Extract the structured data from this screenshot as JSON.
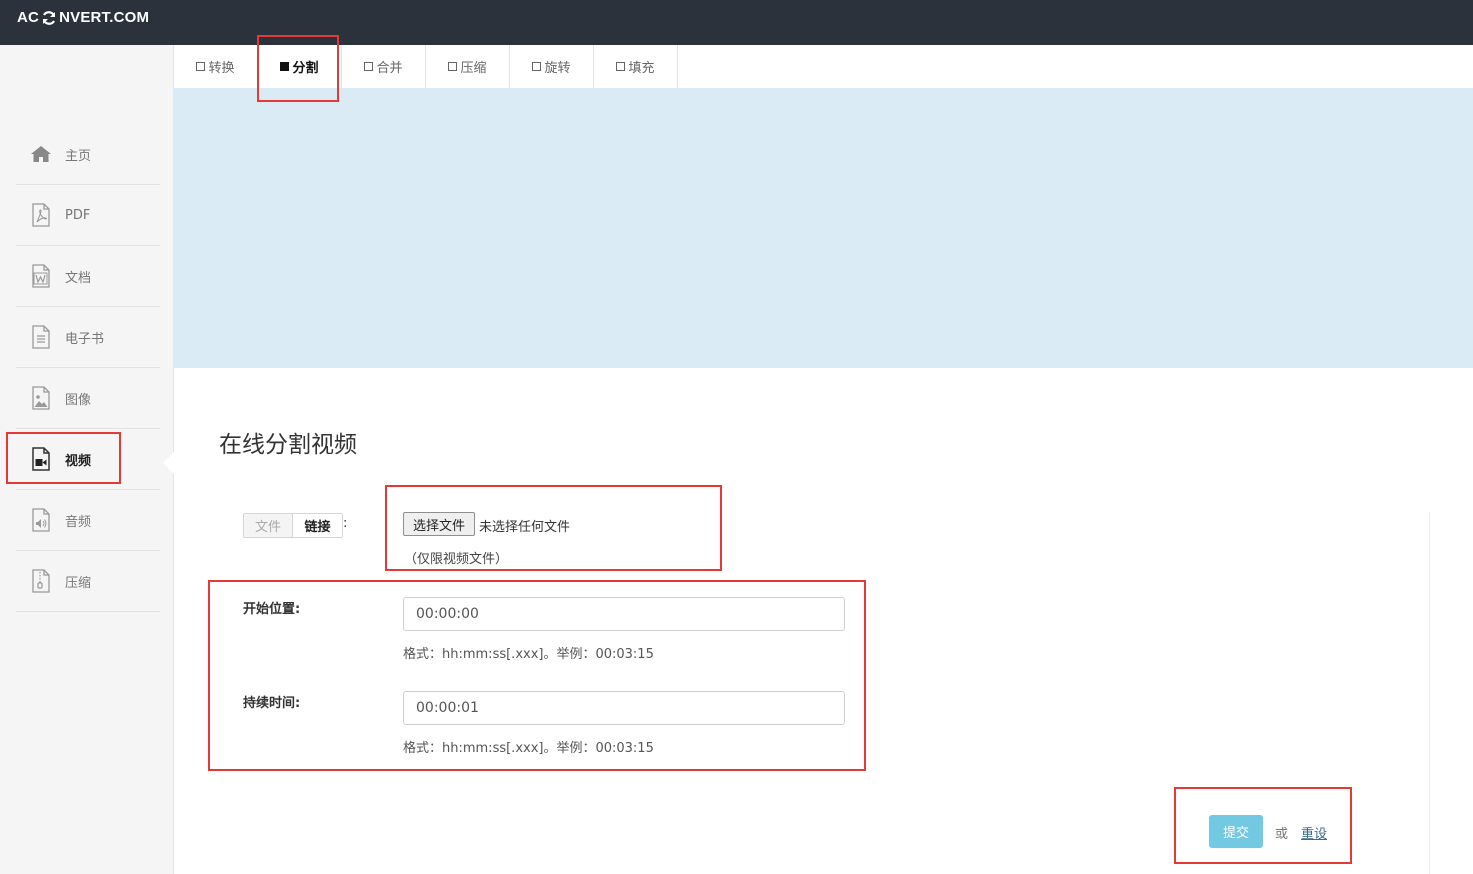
{
  "header": {
    "logo_left": "AC",
    "logo_right": "NVERT.COM"
  },
  "sidebar": {
    "items": [
      {
        "label": "主页",
        "icon": "home-icon"
      },
      {
        "label": "PDF",
        "icon": "pdf-file-icon"
      },
      {
        "label": "文档",
        "icon": "word-document-icon"
      },
      {
        "label": "电子书",
        "icon": "ebook-icon"
      },
      {
        "label": "图像",
        "icon": "image-file-icon"
      },
      {
        "label": "视频",
        "icon": "video-file-icon",
        "active": true
      },
      {
        "label": "音频",
        "icon": "audio-file-icon"
      },
      {
        "label": "压缩",
        "icon": "archive-file-icon"
      }
    ]
  },
  "tabs": [
    {
      "label": "转换"
    },
    {
      "label": "分割",
      "active": true
    },
    {
      "label": "合并"
    },
    {
      "label": "压缩"
    },
    {
      "label": "旋转"
    },
    {
      "label": "填充"
    }
  ],
  "main": {
    "title": "在线分割视频",
    "source_toggle": {
      "file": "文件",
      "link": "链接",
      "colon": ":"
    },
    "file_input": {
      "button": "选择文件",
      "status": "未选择任何文件",
      "hint": "（仅限视频文件）"
    },
    "start": {
      "label": "开始位置:",
      "value": "00:00:00",
      "help": "格式：hh:mm:ss[.xxx]。举例：00:03:15"
    },
    "duration": {
      "label": "持续时间:",
      "value": "00:00:01",
      "help": "格式：hh:mm:ss[.xxx]。举例：00:03:15"
    },
    "actions": {
      "submit": "提交",
      "or": "或",
      "reset": "重设"
    }
  },
  "colors": {
    "topbar": "#2b323c",
    "banner": "#daebf5",
    "submit": "#5bc0de",
    "highlight": "#e53935"
  }
}
